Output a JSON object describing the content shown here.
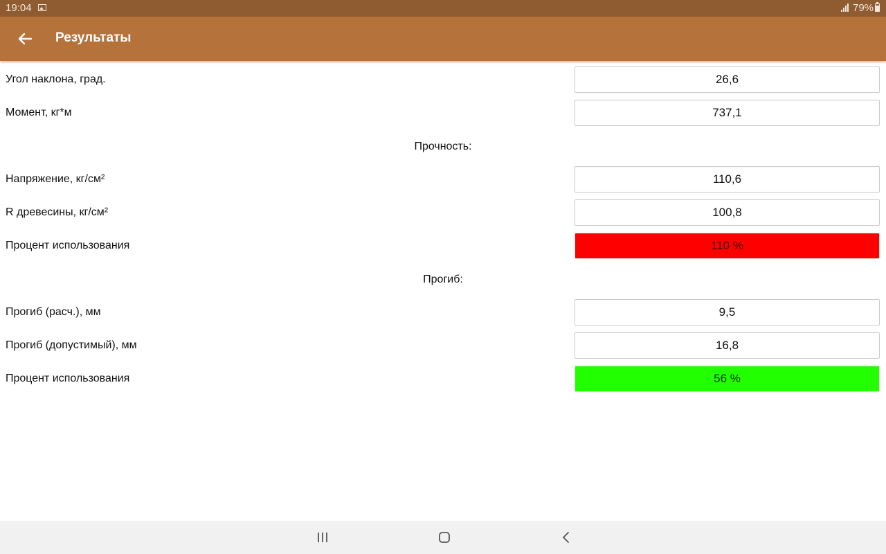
{
  "status": {
    "time": "19:04",
    "battery": "79%"
  },
  "appbar": {
    "title": "Результаты",
    "back_icon": "arrow-left-icon"
  },
  "rows": {
    "angle": {
      "label": "Угол наклона, град.",
      "value": "26,6"
    },
    "moment": {
      "label": "Момент, кг*м",
      "value": "737,1"
    },
    "stress": {
      "label": "Напряжение, кг/см²",
      "value": "110,6"
    },
    "r_wood": {
      "label": "R древесины, кг/см²",
      "value": "100,8"
    },
    "strength_usage": {
      "label": "Процент использования",
      "value": "110 %",
      "color": "#ff0000"
    },
    "deflection_calc": {
      "label": "Прогиб (расч.), мм",
      "value": "9,5"
    },
    "deflection_allowed": {
      "label": "Прогиб (допустимый), мм",
      "value": "16,8"
    },
    "deflection_usage": {
      "label": "Процент использования",
      "value": "56 %",
      "color": "#22ff00"
    }
  },
  "sections": {
    "strength": "Прочность:",
    "deflection": "Прогиб:"
  },
  "nav": {
    "recents_icon": "recents-icon",
    "home_icon": "home-icon",
    "back_icon": "back-icon"
  }
}
